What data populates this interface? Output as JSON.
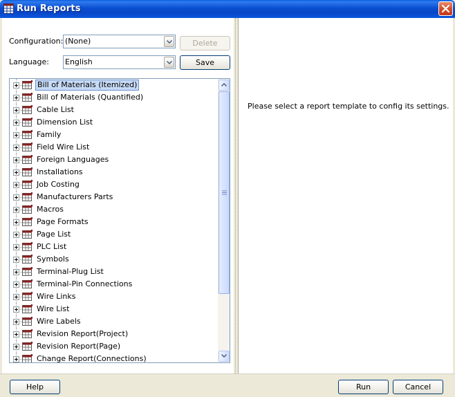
{
  "window": {
    "title": "Run Reports"
  },
  "config": {
    "configuration_label": "Configuration:",
    "configuration_value": "(None)",
    "language_label": "Language:",
    "language_value": "English",
    "delete_label": "Delete",
    "save_label": "Save"
  },
  "tree": {
    "items": [
      {
        "label": "Bill of Materials (Itemized)",
        "selected": true
      },
      {
        "label": "Bill of Materials (Quantified)"
      },
      {
        "label": "Cable List"
      },
      {
        "label": "Dimension List"
      },
      {
        "label": "Family"
      },
      {
        "label": "Field Wire List"
      },
      {
        "label": "Foreign Languages"
      },
      {
        "label": "Installations"
      },
      {
        "label": "Job Costing"
      },
      {
        "label": "Manufacturers Parts"
      },
      {
        "label": "Macros"
      },
      {
        "label": "Page Formats"
      },
      {
        "label": "Page List"
      },
      {
        "label": "PLC List"
      },
      {
        "label": "Symbols"
      },
      {
        "label": "Terminal-Plug List"
      },
      {
        "label": "Terminal-Pin Connections"
      },
      {
        "label": "Wire Links"
      },
      {
        "label": "Wire List"
      },
      {
        "label": "Wire Labels"
      },
      {
        "label": "Revision Report(Project)"
      },
      {
        "label": "Revision Report(Page)"
      },
      {
        "label": "Change Report(Connections)"
      }
    ]
  },
  "right_pane": {
    "hint": "Please select a report template to config its settings."
  },
  "footer": {
    "help_label": "Help",
    "run_label": "Run",
    "cancel_label": "Cancel"
  },
  "colors": {
    "title_bar": "#0a4fd0",
    "selection": "#c6daf5",
    "window_bg": "#ece9d8"
  }
}
